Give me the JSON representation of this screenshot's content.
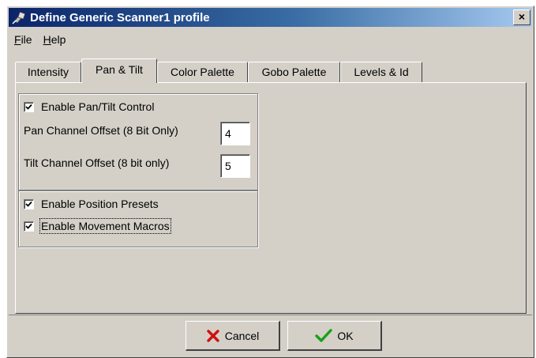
{
  "window": {
    "title": "Define Generic Scanner1 profile",
    "close_glyph": "×"
  },
  "menu": [
    {
      "label": "File",
      "mnemonic": "F",
      "rest": "ile"
    },
    {
      "label": "Help",
      "mnemonic": "H",
      "rest": "elp"
    }
  ],
  "tabs": [
    {
      "label": "Intensity",
      "active": false
    },
    {
      "label": "Pan & Tilt",
      "active": true
    },
    {
      "label": "Color Palette",
      "active": false
    },
    {
      "label": "Gobo Palette",
      "active": false
    },
    {
      "label": "Levels & Id",
      "active": false
    }
  ],
  "pan_tilt": {
    "enable_label": "Enable Pan/Tilt Control",
    "enable_checked": true,
    "pan_label": "Pan Channel Offset (8 Bit Only)",
    "pan_value": "4",
    "tilt_label": "Tilt Channel Offset (8 bit only)",
    "tilt_value": "5"
  },
  "options": {
    "presets_label": "Enable Position Presets",
    "presets_checked": true,
    "macros_label": "Enable Movement Macros",
    "macros_checked": true
  },
  "buttons": {
    "cancel": "Cancel",
    "ok": "OK"
  },
  "icons": {
    "title": "scanner-fixture-icon",
    "cancel": "red-x-icon",
    "ok": "green-check-icon",
    "check": "checkmark-icon"
  }
}
